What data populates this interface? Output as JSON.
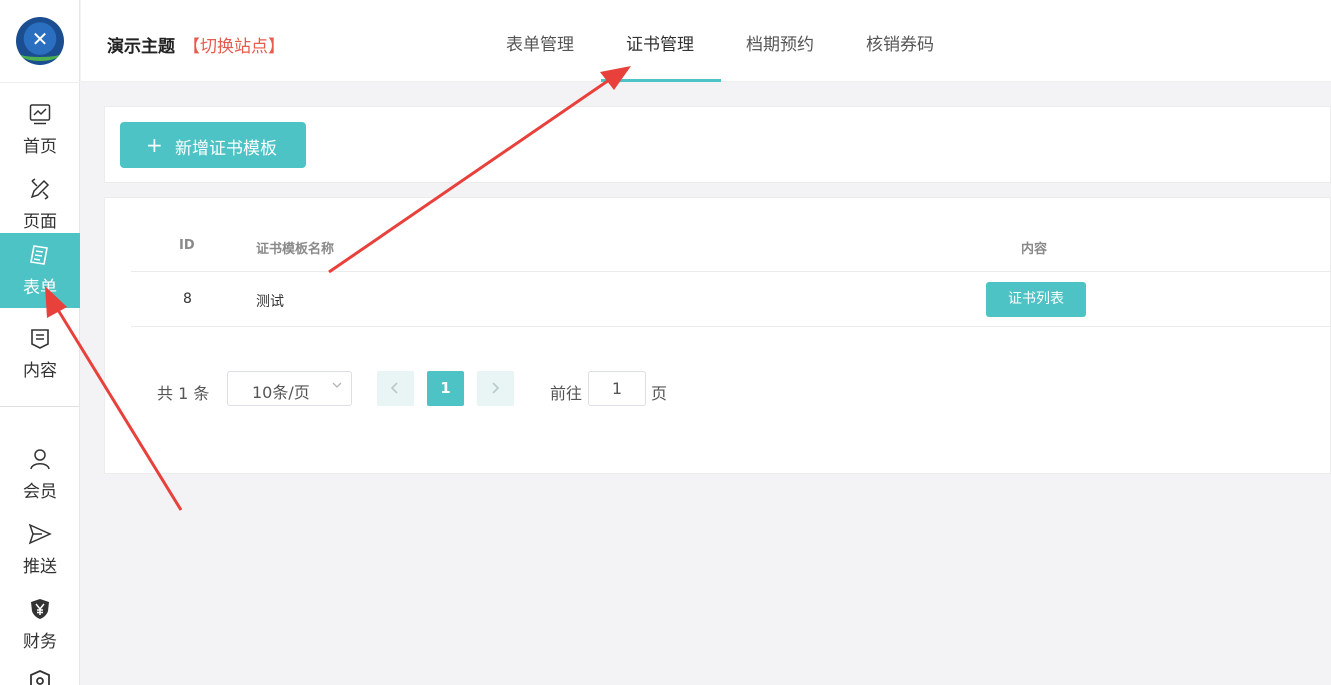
{
  "header": {
    "site_title": "演示主题",
    "switch_site": "【切换站点】",
    "tabs": [
      {
        "label": "表单管理",
        "active": false
      },
      {
        "label": "证书管理",
        "active": true
      },
      {
        "label": "档期预约",
        "active": false
      },
      {
        "label": "核销券码",
        "active": false
      }
    ]
  },
  "sidebar": {
    "items": [
      {
        "label": "首页",
        "icon": "chart-icon"
      },
      {
        "label": "页面",
        "icon": "design-tools-icon"
      },
      {
        "label": "表单",
        "icon": "form-icon",
        "active": true
      },
      {
        "label": "内容",
        "icon": "content-icon"
      },
      {
        "label": "会员",
        "icon": "user-icon"
      },
      {
        "label": "推送",
        "icon": "send-icon"
      },
      {
        "label": "财务",
        "icon": "yen-shield-icon"
      }
    ]
  },
  "toolbar": {
    "add_button": "新增证书模板",
    "add_icon": "+"
  },
  "table": {
    "columns": [
      "ID",
      "证书模板名称",
      "内容"
    ],
    "rows": [
      {
        "id": "8",
        "name": "测试",
        "action": "证书列表"
      }
    ]
  },
  "pagination": {
    "total": "共 1 条",
    "page_size": "10条/页",
    "current_page": "1",
    "goto_label": "前往",
    "goto_value": "1",
    "goto_suffix": "页"
  },
  "colors": {
    "accent": "#4dc3c5",
    "switch_site": "#e55b4d",
    "annotation_arrow": "#e8413c"
  }
}
